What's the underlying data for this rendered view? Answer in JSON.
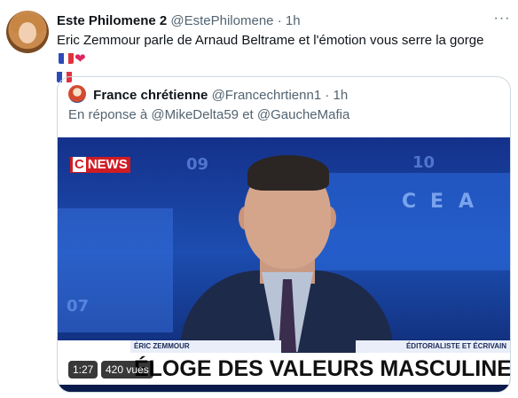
{
  "tweet": {
    "display_name": "Este Philomene 2",
    "handle": "@EstePhilomene",
    "dot": "·",
    "time": "1h",
    "more": "···",
    "text": "Eric Zemmour parle de Arnaud Beltrame  et l'émotion vous serre la gorge"
  },
  "quoted": {
    "display_name": "France chrétienne",
    "handle": "@Francechrtienn1",
    "dot": "·",
    "time": "1h",
    "reply_prefix": "En réponse à",
    "mention_1": "@MikeDelta59",
    "reply_join": "et",
    "mention_2": "@GaucheMafia"
  },
  "video": {
    "channel_logo_c": "C",
    "channel_logo_rest": "NEWS",
    "bg_letters": [
      "C",
      "E",
      "A"
    ],
    "bg_numbers": [
      "09",
      "10",
      "07"
    ],
    "speaker_name": "ÉRIC ZEMMOUR",
    "speaker_role": "ÉDITORIALISTE ET ÉCRIVAIN",
    "banner": "ÉLOGE DES VALEURS MASCULINES",
    "duration": "1:27",
    "views": "420 vues"
  },
  "colors": {
    "text_primary": "#0f1419",
    "text_secondary": "#536471",
    "border": "#cfd9de",
    "cnews_red": "#d01c24",
    "heart": "#e0245e"
  }
}
